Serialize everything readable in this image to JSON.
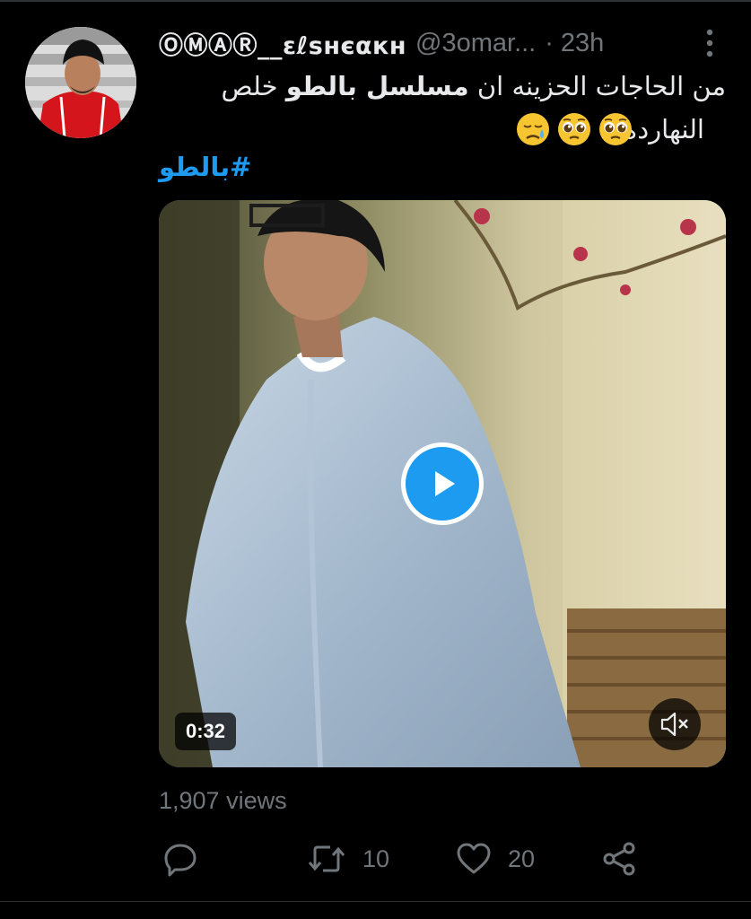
{
  "author": {
    "display_name": "ⓄⓂⒶⓇ__ɛℓѕнєαкн",
    "handle": "@3omar...",
    "separator": "·",
    "time": "23h"
  },
  "tweet": {
    "line1_part_a": "من الحاجات الحزينه ان ",
    "line1_bold": "مسلسل بالطو",
    "line1_part_b": " خلص",
    "line2": "النهارده",
    "emojis": [
      "pleading-face",
      "pleading-face",
      "sad-relieved-face"
    ],
    "hashtag": "#بالطو"
  },
  "video": {
    "duration": "0:32",
    "play_icon": "play-icon",
    "mute_icon": "speaker-muted-icon"
  },
  "stats": {
    "views": "1,907 views",
    "replies": "",
    "retweets": "10",
    "likes": "20"
  },
  "colors": {
    "background": "#000000",
    "text": "#e7e9ea",
    "secondary": "#71767b",
    "accent": "#1d9bf0"
  }
}
